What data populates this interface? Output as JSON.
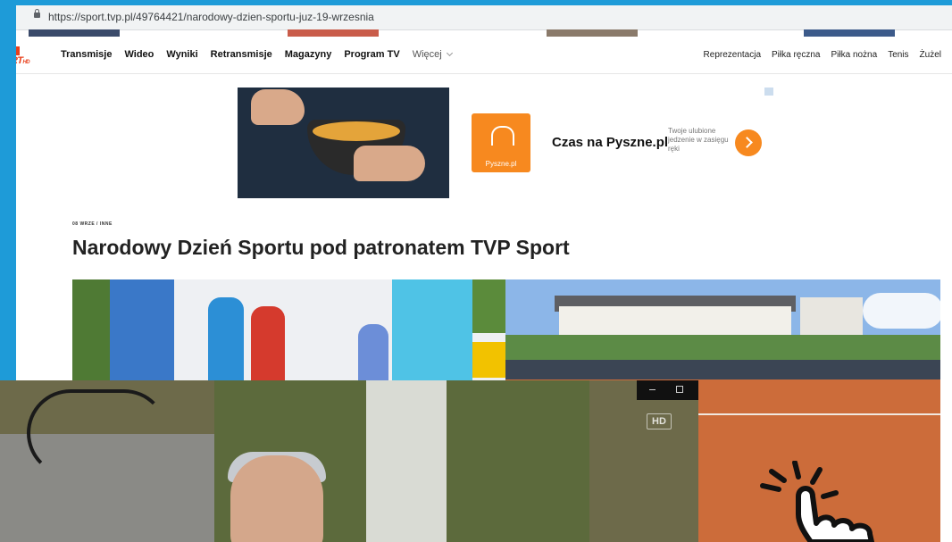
{
  "browser": {
    "url": "https://sport.tvp.pl/49764421/narodowy-dzien-sportu-juz-19-wrzesnia"
  },
  "site": {
    "logo_text": "RT",
    "logo_suffix": "HD",
    "nav_left": [
      "Transmisje",
      "Wideo",
      "Wyniki",
      "Retransmisje",
      "Magazyny",
      "Program TV"
    ],
    "nav_more": "Więcej",
    "nav_right": [
      "Reprezentacja",
      "Piłka ręczna",
      "Piłka nożna",
      "Tenis",
      "Żużel"
    ]
  },
  "ad": {
    "brand": "Pyszne.pl",
    "title": "Czas na Pyszne.pl",
    "subtitle": "Twoje ulubione jedzenie w zasięgu ręki",
    "accent": "#f7891f"
  },
  "article": {
    "breadcrumb": "08 WRZE / INNE",
    "headline": "Narodowy Dzień Sportu pod patronatem TVP Sport"
  },
  "video": {
    "badge": "HD"
  },
  "icons": [
    "lock-icon",
    "chevron-down-icon",
    "arrow-right-icon",
    "minimize-icon",
    "restore-icon",
    "hand-pointer-icon"
  ]
}
